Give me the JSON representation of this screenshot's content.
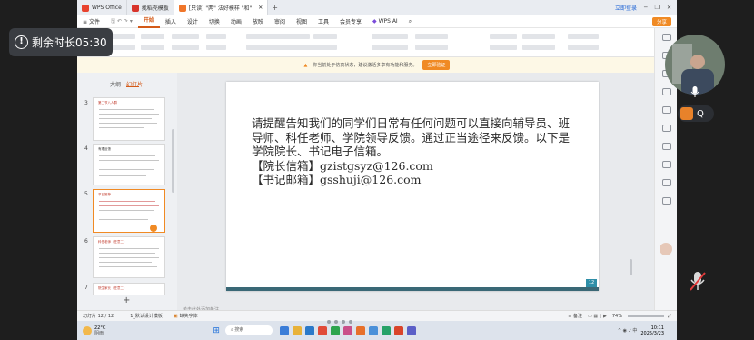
{
  "timer": {
    "label": "剩余时长05:30"
  },
  "qbadge": {
    "label": "Q"
  },
  "tabs": [
    {
      "label": "WPS Office",
      "color": "#e8432e"
    },
    {
      "label": "找稻壳模板",
      "color": "#d8342b"
    },
    {
      "label": "[只读] \"两\" 法好模样 \"和\"",
      "color": "#f0762a"
    }
  ],
  "window": {
    "login": "立即登录",
    "share": "分享"
  },
  "menu": {
    "file": "文件",
    "items": [
      "开始",
      "插入",
      "设计",
      "切换",
      "动画",
      "放映",
      "审阅",
      "视图",
      "工具",
      "会员专享"
    ],
    "wps_ai": "WPS AI"
  },
  "notice": {
    "text": "你当前处于仿真状态，建议激活多享有功能和服务。",
    "button": "立即验证"
  },
  "panel": {
    "tab_outline": "大纲",
    "tab_slides": "幻灯片",
    "add": "+"
  },
  "thumbs": [
    {
      "num": "3",
      "title": "第二节八人群"
    },
    {
      "num": "4",
      "title": "有理反馈"
    },
    {
      "num": "5",
      "title": "节目推荐"
    },
    {
      "num": "6",
      "title": "科任老师（任意二）"
    },
    {
      "num": "7",
      "title": "院生家长（任意二）"
    }
  ],
  "slide": {
    "body": "请提醒告知我们的同学们日常有任何问题可以直接向辅导员、班导师、科任老师、学院领导反馈。通过正当途径来反馈。以下是学院院长、书记电子信箱。",
    "line1": "【院长信箱】gzistgsyz@126.com",
    "line2": "【书记邮箱】gsshuji@126.com",
    "page": "12"
  },
  "notes": {
    "placeholder": "单击此处添加备注"
  },
  "status": {
    "slide": "幻灯片 12 / 12",
    "theme": "1_默认设计模板",
    "font": "缺失字体",
    "notes": "备注",
    "zoom": "74%"
  },
  "taskbar": {
    "temp": "22°C",
    "weather": "阴雨",
    "search": "搜索",
    "time": "10:11",
    "date": "2025/3/23"
  }
}
